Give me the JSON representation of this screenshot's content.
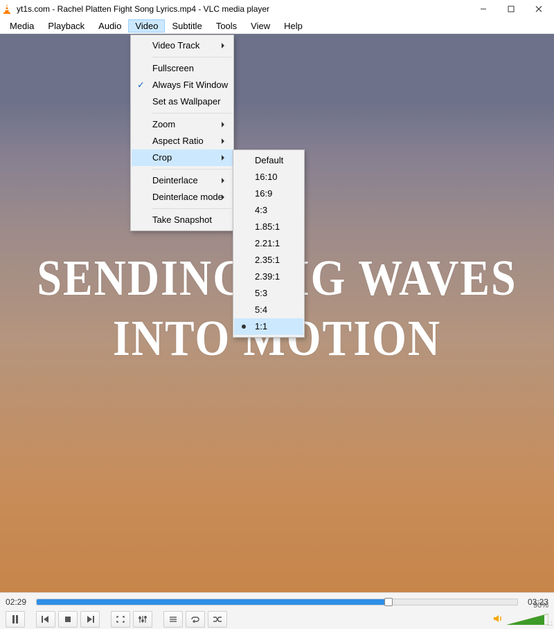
{
  "window": {
    "title": "yt1s.com - Rachel Platten  Fight Song Lyrics.mp4 - VLC media player"
  },
  "menubar": {
    "items": [
      "Media",
      "Playback",
      "Audio",
      "Video",
      "Subtitle",
      "Tools",
      "View",
      "Help"
    ],
    "active_index": 3
  },
  "video_menu": {
    "items": [
      {
        "label": "Video Track",
        "submenu": true
      },
      {
        "sep": true
      },
      {
        "label": "Fullscreen"
      },
      {
        "label": "Always Fit Window",
        "checked": true
      },
      {
        "label": "Set as Wallpaper"
      },
      {
        "sep": true
      },
      {
        "label": "Zoom",
        "submenu": true
      },
      {
        "label": "Aspect Ratio",
        "submenu": true
      },
      {
        "label": "Crop",
        "submenu": true,
        "highlight": true
      },
      {
        "sep": true
      },
      {
        "label": "Deinterlace",
        "submenu": true
      },
      {
        "label": "Deinterlace mode",
        "submenu": true
      },
      {
        "sep": true
      },
      {
        "label": "Take Snapshot"
      }
    ]
  },
  "crop_menu": {
    "items": [
      {
        "label": "Default"
      },
      {
        "label": "16:10"
      },
      {
        "label": "16:9"
      },
      {
        "label": "4:3"
      },
      {
        "label": "1.85:1"
      },
      {
        "label": "2.21:1"
      },
      {
        "label": "2.35:1"
      },
      {
        "label": "2.39:1"
      },
      {
        "label": "5:3"
      },
      {
        "label": "5:4"
      },
      {
        "label": "1:1",
        "highlight": true,
        "bullet": true
      }
    ]
  },
  "lyrics": {
    "line1": "SENDING BIG WAVES",
    "line2": "INTO MOTION"
  },
  "player": {
    "time_current": "02:29",
    "time_total": "03:23",
    "seek_percent": 73,
    "volume_percent": 90,
    "volume_label": "90%"
  }
}
